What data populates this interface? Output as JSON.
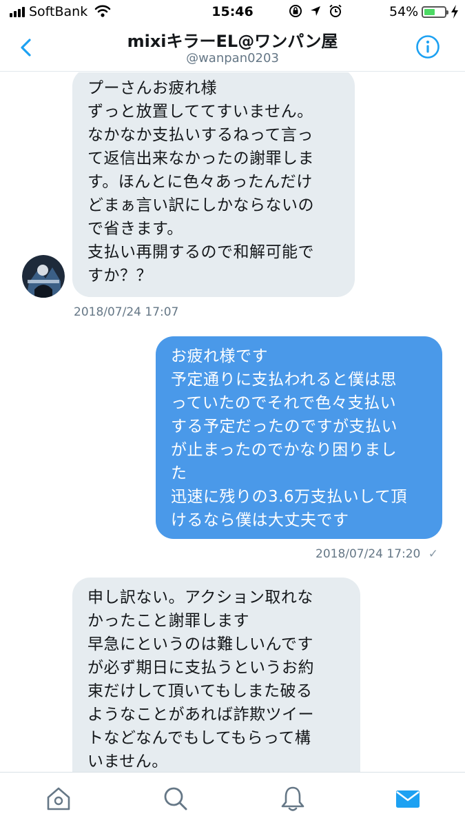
{
  "status": {
    "carrier": "SoftBank",
    "time": "15:46",
    "battery_percent": "54%",
    "battery_level": 0.54
  },
  "header": {
    "title": "mixiキラーEL@ワンパン屋",
    "handle": "@wanpan0203"
  },
  "messages": [
    {
      "direction": "received",
      "text": "プーさんお疲れ様\nずっと放置しててすいません。\nなかなか支払いするねって言っ\nて返信出来なかったの謝罪しま\nす。ほんとに色々あったんだけ\nどまぁ言い訳にしかならないの\nで省きます。\n支払い再開するので和解可能で\nすか？？",
      "timestamp": "2018/07/24 17:07"
    },
    {
      "direction": "sent",
      "text": "お疲れ様です\n予定通りに支払われると僕は思\nっていたのでそれで色々支払い\nする予定だったのですが支払い\nが止まったのでかなり困りまし\nた\n迅速に残りの3.6万支払いして頂\nけるなら僕は大丈夫です",
      "timestamp": "2018/07/24 17:20",
      "read_mark": "✓"
    },
    {
      "direction": "received",
      "text": "申し訳ない。アクション取れな\nかったこと謝罪します\n早急にというのは難しいんです\nが必ず期日に支払うというお約\n束だけして頂いてもしまた破る\nようなことがあれば詐欺ツイー\nトなどなんでもしてもらって構\nいません。"
    }
  ],
  "icons": {
    "back": "chevron-left-icon",
    "info": "info-icon",
    "tabs": [
      "home-icon",
      "search-icon",
      "bell-icon",
      "mail-icon"
    ]
  },
  "colors": {
    "accent": "#1da1f2",
    "sent_bubble": "#4a99e9",
    "received_bubble": "#e6ecf0",
    "timestamp": "#657786"
  }
}
